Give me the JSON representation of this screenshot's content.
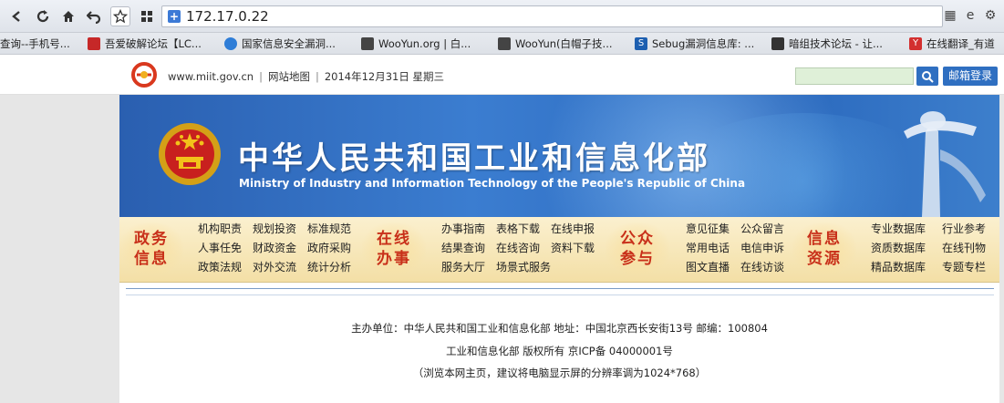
{
  "browser": {
    "url": "172.17.0.22",
    "bookmarks": [
      {
        "label": "查询--手机号...",
        "color": "#ffffff"
      },
      {
        "label": "吾爱破解论坛【LC...",
        "color": "#c62828"
      },
      {
        "label": "国家信息安全漏洞...",
        "color": "#2e7dd7"
      },
      {
        "label": "WooYun.org | 白...",
        "color": "#444444"
      },
      {
        "label": "WooYun(白帽子技...",
        "color": "#444444"
      },
      {
        "label": "Sebug漏洞信息库: ...",
        "color": "#1d5fb0"
      },
      {
        "label": "暗组技术论坛 - 让...",
        "color": "#333333"
      },
      {
        "label": "在线翻译_有道",
        "color": "#d32f2f"
      }
    ]
  },
  "site": {
    "domain": "www.miit.gov.cn",
    "sitemap": "网站地图",
    "date": "2014年12月31日 星期三",
    "mail_login": "邮箱登录"
  },
  "banner": {
    "title": "中华人民共和国工业和信息化部",
    "subtitle": "Ministry of Industry and Information Technology of the People's Republic of China"
  },
  "nav": [
    {
      "category": [
        "政务",
        "信息"
      ],
      "links": [
        "机构职责",
        "规划投资",
        "标准规范",
        "人事任免",
        "财政资金",
        "政府采购",
        "政策法规",
        "对外交流",
        "统计分析"
      ]
    },
    {
      "category": [
        "在线",
        "办事"
      ],
      "links": [
        "办事指南",
        "表格下载",
        "在线申报",
        "结果查询",
        "在线咨询",
        "资料下载",
        "服务大厅",
        "场景式服务"
      ]
    },
    {
      "category": [
        "公众",
        "参与"
      ],
      "links": [
        "意见征集",
        "公众留言",
        "常用电话",
        "电信申诉",
        "图文直播",
        "在线访谈"
      ]
    },
    {
      "category": [
        "信息",
        "资源"
      ],
      "links": [
        "专业数据库",
        "行业参考",
        "资质数据库",
        "在线刊物",
        "精品数据库",
        "专题专栏"
      ]
    }
  ],
  "footer": {
    "line1": "主办单位：中华人民共和国工业和信息化部  地址：中国北京西长安街13号  邮编：100804",
    "line2": "工业和信息化部 版权所有 京ICP备 04000001号",
    "line3": "（浏览本网主页，建议将电脑显示屏的分辨率调为1024*768）"
  }
}
